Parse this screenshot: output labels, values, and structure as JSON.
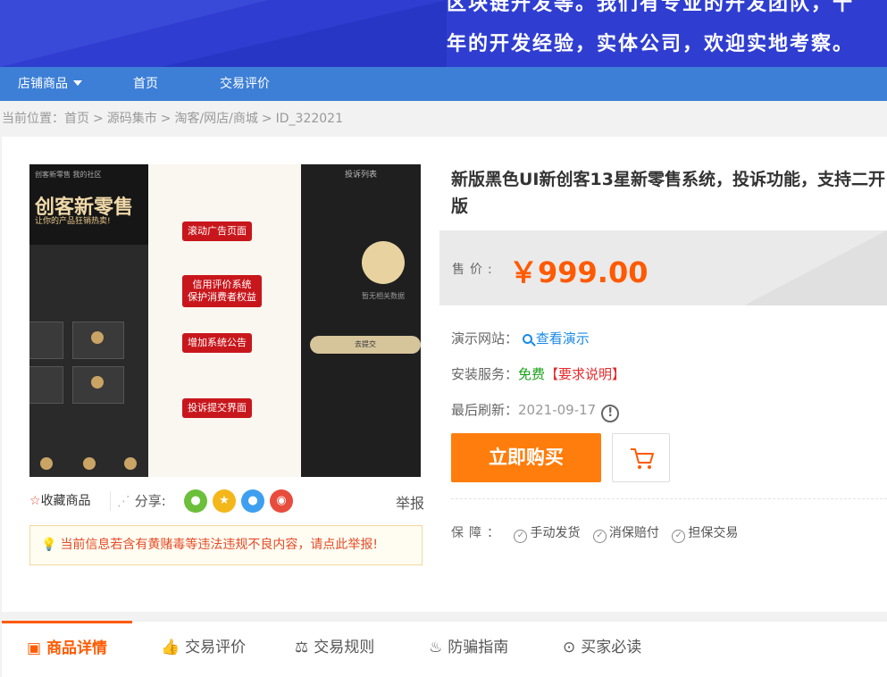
{
  "banner": {
    "line1": "区块链开发等。我们有专业的开发团队，十",
    "line2": "年的开发经验，实体公司，欢迎实地考察。"
  },
  "nav": {
    "items": [
      "店铺商品",
      "首页",
      "交易评价"
    ]
  },
  "breadcrumb": {
    "prefix": "当前位置：",
    "items": [
      "首页",
      "源码集市",
      "淘客/网店/商城",
      "ID_322021"
    ],
    "separator": ">"
  },
  "gallery": {
    "left_title": "创客新零售",
    "left_subtitle": "让你的产品狂销热卖!",
    "left_header": "创客新零售    我的社区",
    "tags": [
      "滚动广告页面",
      "信用评价系统\n保护消费者权益",
      "增加系统公告",
      "投诉提交界面"
    ],
    "right_title": "投诉列表",
    "right_nodata": "暂无相关数据",
    "right_button": "去提交"
  },
  "actions": {
    "favorite": "收藏商品",
    "share": "分享:",
    "report": "举报"
  },
  "notice": "当前信息若含有黄赌毒等违法违规不良内容，请点此举报!",
  "product": {
    "title": "新版黑色UI新创客13星新零售系统，投诉功能，支持二开版",
    "price_label": "售价:",
    "price": "￥999.00",
    "demo_label": "演示网站：",
    "demo_link": "查看演示",
    "install_label": "安装服务：",
    "install_value": "免费",
    "install_req": "【要求说明】",
    "refresh_label": "最后刷新：",
    "refresh_value": "2021-09-17",
    "buy_button": "立即购买",
    "guarantee_label": "保障：",
    "guarantees": [
      "手动发货",
      "消保赔付",
      "担保交易"
    ]
  },
  "tabs": [
    "商品详情",
    "交易评价",
    "交易规则",
    "防骗指南",
    "买家必读"
  ],
  "colors": {
    "accent": "#ff5a00",
    "nav": "#3d7fd6",
    "buy": "#ff7d0c"
  }
}
